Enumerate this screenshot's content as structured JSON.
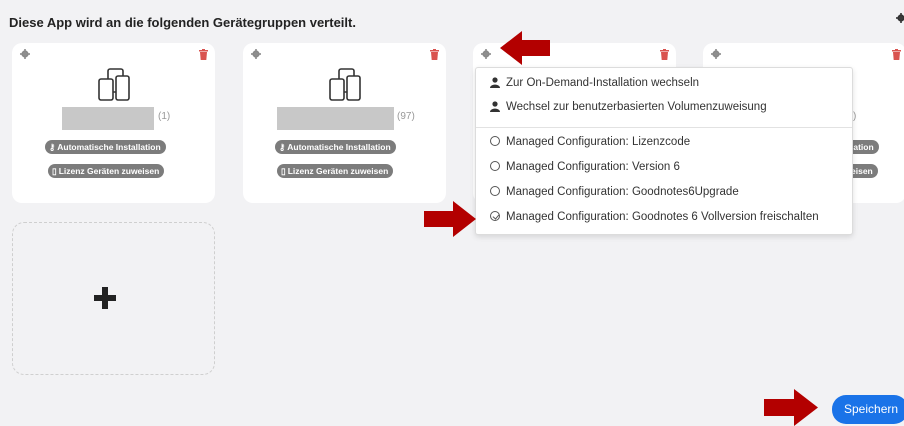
{
  "heading": "Diese App wird an die folgenden Gerätegruppen verteilt.",
  "cards": [
    {
      "count": "(1)",
      "auto_install": "Automatische Installation",
      "license": "Lizenz Geräten zuweisen"
    },
    {
      "count": "(97)",
      "auto_install": "Automatische Installation",
      "license": "Lizenz Geräten zuweisen"
    },
    {},
    {
      "count": ")",
      "auto_install": "lation",
      "license": "eisen"
    }
  ],
  "menu": {
    "items": [
      {
        "label": "Zur On-Demand-Installation wechseln",
        "icon": "user-icon"
      },
      {
        "label": "Wechsel zur benutzerbasierten Volumenzuweisung",
        "icon": "user-icon"
      },
      {
        "label": "Managed Configuration: Lizenzcode",
        "icon": "radio-empty-icon"
      },
      {
        "label": "Managed Configuration: Version 6",
        "icon": "radio-empty-icon"
      },
      {
        "label": "Managed Configuration: Goodnotes6Upgrade",
        "icon": "radio-empty-icon"
      },
      {
        "label": "Managed Configuration: Goodnotes 6 Vollversion freischalten",
        "icon": "check-circle-icon"
      }
    ]
  },
  "save_label": "Speichern",
  "colors": {
    "trash": "#d9534f",
    "arrow": "#b30000",
    "primary": "#1a73e8",
    "pill": "#7c7c7c"
  }
}
